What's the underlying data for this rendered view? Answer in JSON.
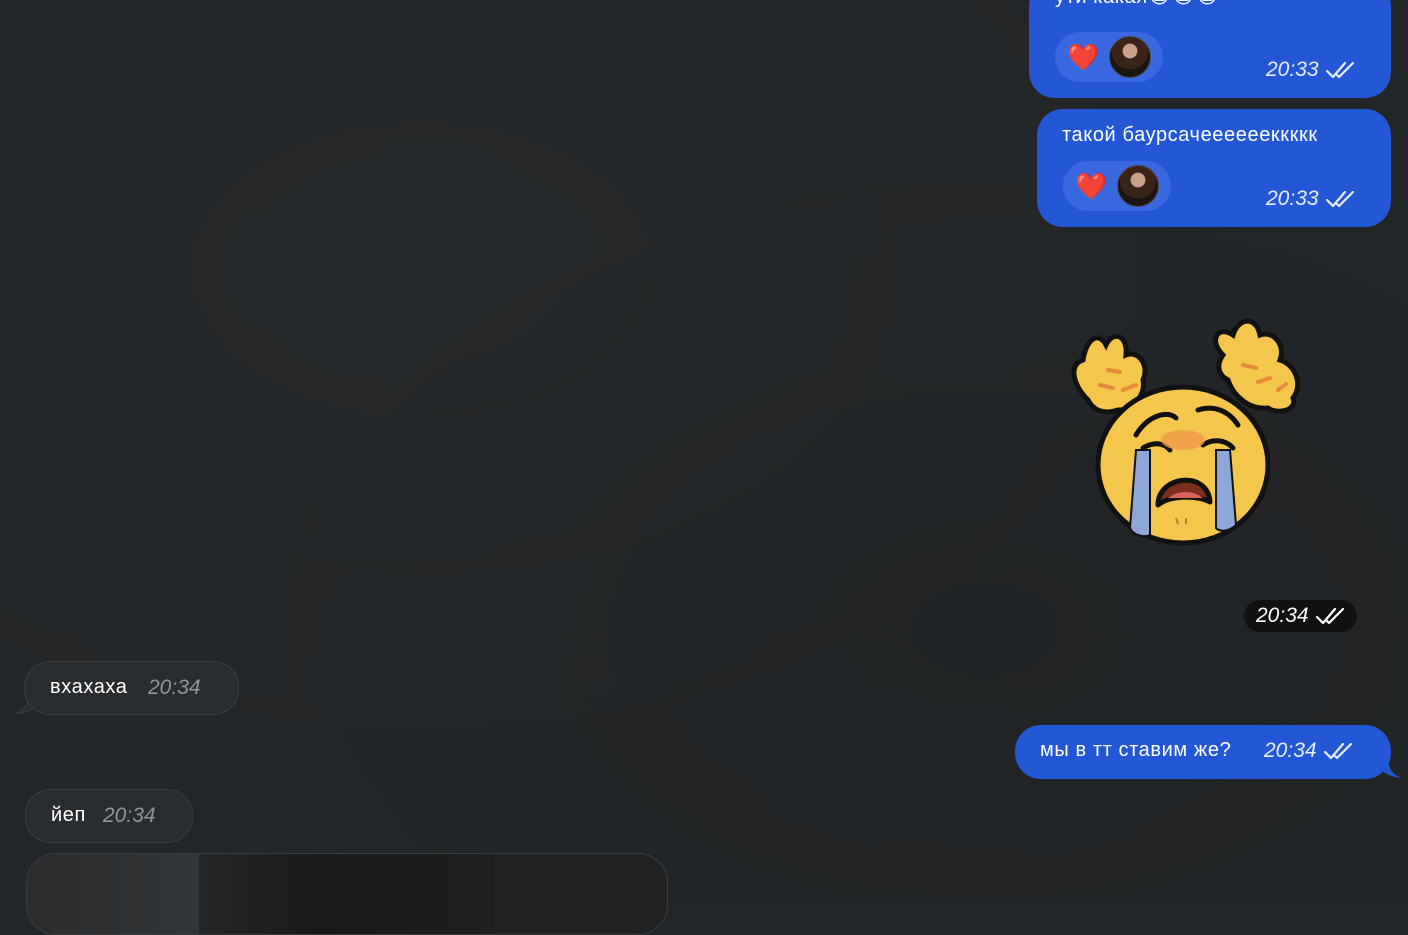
{
  "messages": {
    "out1": {
      "text": "ути какая😭😭😭",
      "time": "20:33",
      "reaction": "❤️"
    },
    "out2": {
      "text": "такой баурсачееееееккккк",
      "time": "20:33",
      "reaction": "❤️"
    },
    "sticker": {
      "time": "20:34",
      "icon": "crying-emoji-sticker"
    },
    "in1": {
      "text": "вхахаха",
      "time": "20:34"
    },
    "out3": {
      "text": "мы в тт ставим же?",
      "time": "20:34"
    },
    "in2": {
      "text": "йеп",
      "time": "20:34"
    }
  },
  "colors": {
    "background": "#232628",
    "outgoing_bubble": "#2457d6",
    "incoming_bubble": "#2a2d30",
    "reaction_pill": "#3a68e0"
  }
}
